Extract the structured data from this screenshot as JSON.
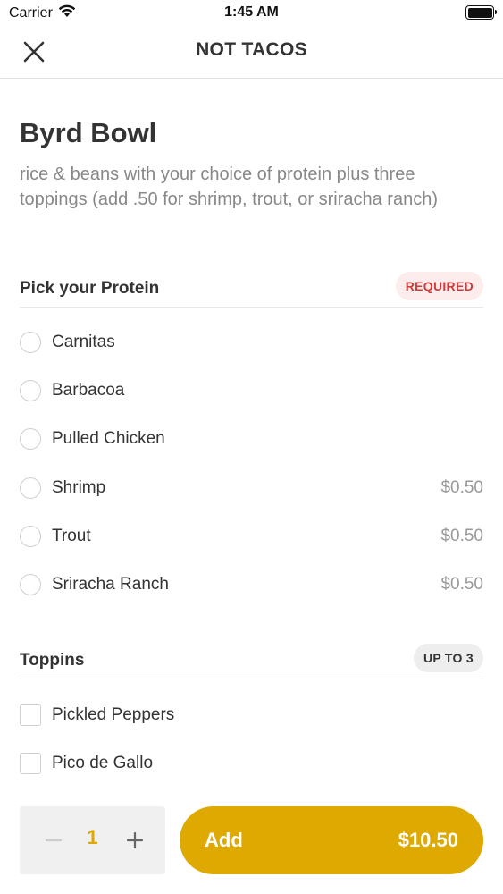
{
  "status_bar": {
    "carrier": "Carrier",
    "time": "1:45 AM"
  },
  "nav": {
    "title": "NOT TACOS",
    "close_icon": "close-icon"
  },
  "item": {
    "title": "Byrd Bowl",
    "description": "rice & beans with your choice of protein plus three toppings (add .50 for shrimp, trout, or sriracha ranch)"
  },
  "protein_section": {
    "title": "Pick your Protein",
    "badge": "REQUIRED",
    "options": [
      {
        "label": "Carnitas",
        "price": ""
      },
      {
        "label": "Barbacoa",
        "price": ""
      },
      {
        "label": "Pulled Chicken",
        "price": ""
      },
      {
        "label": "Shrimp",
        "price": "$0.50"
      },
      {
        "label": "Trout",
        "price": "$0.50"
      },
      {
        "label": "Sriracha Ranch",
        "price": "$0.50"
      }
    ]
  },
  "toppings_section": {
    "title": "Toppins",
    "badge": "UP TO 3",
    "options": [
      {
        "label": "Pickled Peppers"
      },
      {
        "label": "Pico de Gallo"
      }
    ]
  },
  "order": {
    "quantity": "1",
    "minus_icon": "minus-icon",
    "plus_icon": "plus-icon",
    "add_label": "Add",
    "total": "$10.50"
  },
  "colors": {
    "accent": "#DEA900",
    "required_text": "#D23A3A",
    "required_bg": "#FDECEC"
  }
}
